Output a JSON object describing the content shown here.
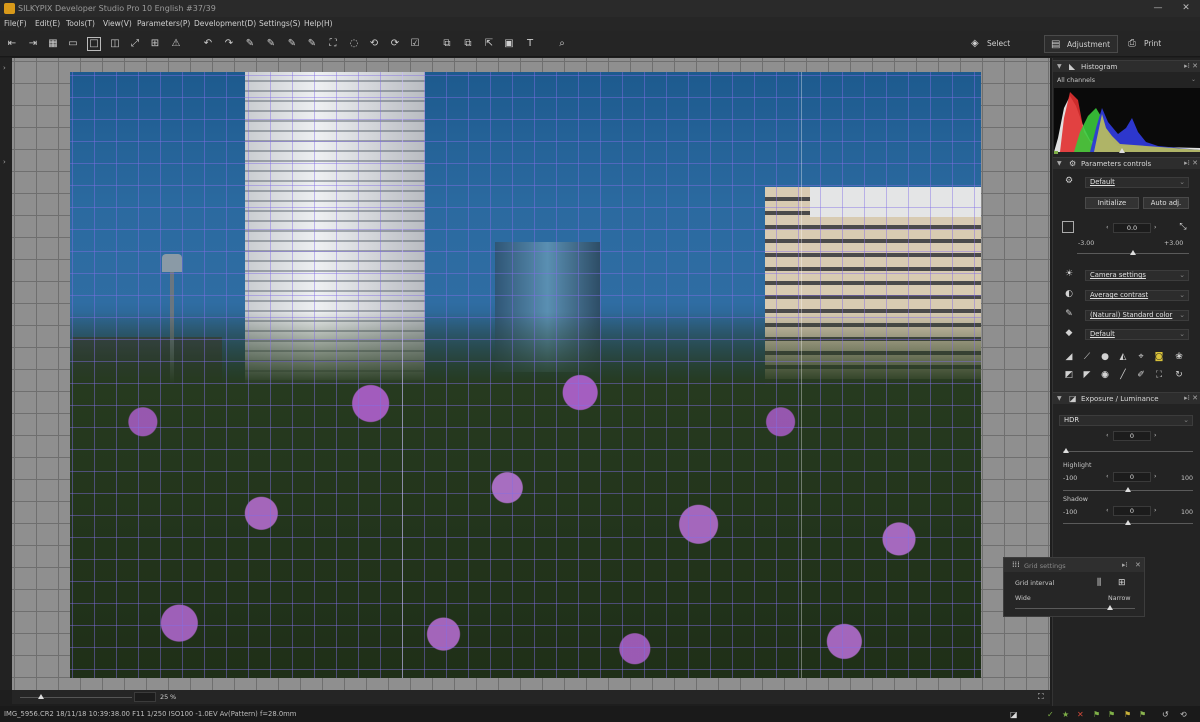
{
  "window": {
    "title": "SILKYPIX Developer Studio Pro 10 English   #37/39",
    "minimize": "—",
    "close": "✕"
  },
  "menu": [
    "File(F)",
    "Edit(E)",
    "Tools(T)",
    "View(V)",
    "Parameters(P)",
    "Development(D)",
    "Settings(S)",
    "Help(H)"
  ],
  "modes": {
    "select": "Select",
    "adjustment": "Adjustment",
    "print": "Print"
  },
  "zoom": {
    "value": "25",
    "unit": "%"
  },
  "status": {
    "info": "IMG_5956.CR2 18/11/18 10:39:38.00 F11 1/250 ISO100 -1.0EV Av(Pattern) f=28.0mm"
  },
  "histogram": {
    "title": "Histogram",
    "channel": "All channels"
  },
  "parameters": {
    "title": "Parameters controls",
    "preset": "Default",
    "initialize": "Initialize",
    "auto_adj": "Auto adj.",
    "exposure_value": "0.0",
    "exposure_min": "-3.00",
    "exposure_max": "+3.00",
    "exposure_level": 0.5,
    "white_balance": "Camera settings",
    "tone": "Average contrast",
    "color": "(Natural) Standard color",
    "sharpness": "Default"
  },
  "exposure": {
    "title": "Exposure / Luminance",
    "hdr_label": "HDR",
    "hdr_value": "0",
    "highlight_label": "Highlight",
    "highlight_value": "0",
    "highlight_min": "-100",
    "highlight_max": "100",
    "shadow_label": "Shadow",
    "shadow_value": "0",
    "shadow_min": "-100",
    "shadow_max": "100"
  },
  "grid_settings": {
    "title": "Grid settings",
    "interval_label": "Grid interval",
    "wide": "Wide",
    "narrow": "Narrow"
  },
  "colors": {
    "accent_green": "#7fb048",
    "bg": "#1e1e1e"
  }
}
